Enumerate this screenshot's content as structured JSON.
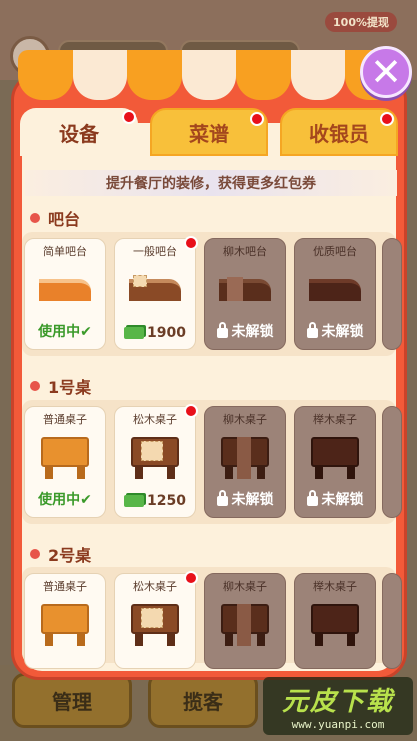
{
  "background": {
    "withdraw_badge": "100%提现",
    "bottom_buttons": [
      "管理",
      "揽客"
    ]
  },
  "watermark": {
    "logo": "元皮下载",
    "url": "www.yuanpi.com"
  },
  "close_button": {
    "label": "✕"
  },
  "tabs": [
    {
      "label": "设备",
      "active": true,
      "has_dot": true
    },
    {
      "label": "菜谱",
      "active": false,
      "has_dot": true
    },
    {
      "label": "收银员",
      "active": false,
      "has_dot": true
    }
  ],
  "banner": "提升餐厅的装修，获得更多红包券",
  "sections": [
    {
      "title": "吧台",
      "items": [
        {
          "name": "简单吧台",
          "status": "使用中",
          "type": "inuse"
        },
        {
          "name": "一般吧台",
          "status": "1900",
          "type": "price",
          "has_dot": true
        },
        {
          "name": "柳木吧台",
          "status": "未解锁",
          "type": "lock"
        },
        {
          "name": "优质吧台",
          "status": "未解锁",
          "type": "lock"
        }
      ]
    },
    {
      "title": "1号桌",
      "items": [
        {
          "name": "普通桌子",
          "status": "使用中",
          "type": "inuse"
        },
        {
          "name": "松木桌子",
          "status": "1250",
          "type": "price",
          "has_dot": true
        },
        {
          "name": "柳木桌子",
          "status": "未解锁",
          "type": "lock"
        },
        {
          "name": "榉木桌子",
          "status": "未解锁",
          "type": "lock"
        }
      ]
    },
    {
      "title": "2号桌",
      "items": [
        {
          "name": "普通桌子",
          "status": "",
          "type": "inuse"
        },
        {
          "name": "松木桌子",
          "status": "",
          "type": "price",
          "has_dot": true
        },
        {
          "name": "柳木桌子",
          "status": "",
          "type": "lock"
        },
        {
          "name": "榉木桌子",
          "status": "",
          "type": "lock"
        }
      ]
    }
  ],
  "colors": {
    "panel": "#f25a39",
    "cream": "#fdf1dc",
    "accent_orange": "#f8a021",
    "tab_yellow": "#f8c03a",
    "dot_red": "#e8101a",
    "in_use_green": "#3b9a2a"
  }
}
